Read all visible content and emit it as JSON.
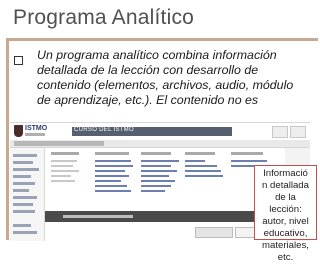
{
  "slide": {
    "title": "Programa Analítico",
    "bullet_lines": [
      "Un programa analítico combina información",
      "detallada de la lección con desarrollo de",
      "contenido (elementos, archivos, audio, módulo",
      "de aprendizaje, etc.). El contenido no es"
    ]
  },
  "callout": {
    "lines": [
      "Informació",
      "n detallada",
      "de la",
      "lección:",
      "autor, nivel",
      "educativo,",
      "materiales,",
      "etc."
    ]
  },
  "screenshot": {
    "logo_text": "ISTMO",
    "course_banner": "CURSO DEL ISTMO"
  },
  "colors": {
    "accent_rule": "#c9a98f",
    "callout_border": "#c0504d",
    "header_band": "#555f70"
  }
}
